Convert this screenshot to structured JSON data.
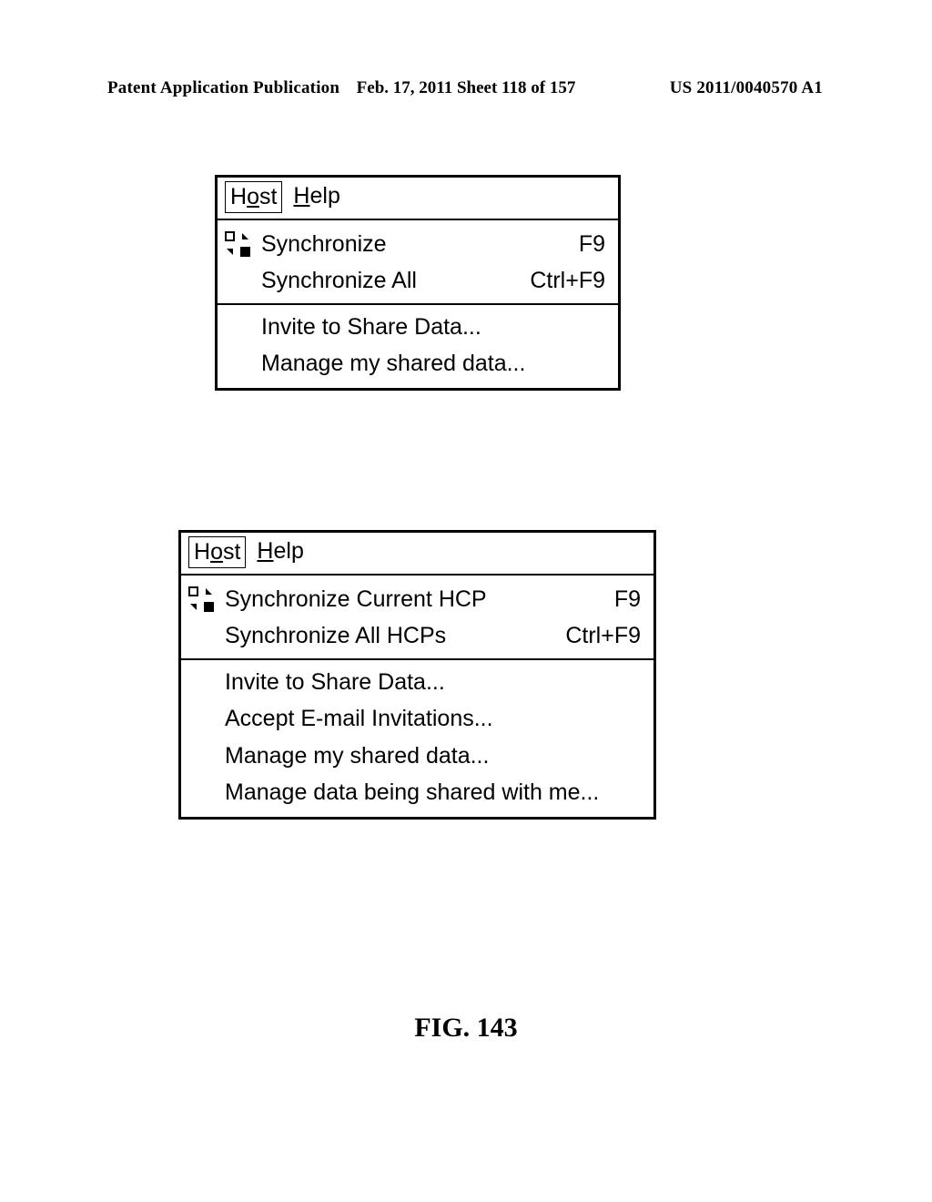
{
  "header": {
    "left": "Patent Application Publication",
    "mid": "Feb. 17, 2011  Sheet 118 of 157",
    "right": "US 2011/0040570 A1"
  },
  "menu1": {
    "menubar": {
      "host_prefix": "H",
      "host_under": "o",
      "host_suffix": "st",
      "help_under": "H",
      "help_suffix": "elp"
    },
    "items": [
      {
        "icon": true,
        "label": "Synchronize",
        "shortcut": "F9"
      },
      {
        "icon": false,
        "label": "Synchronize All",
        "shortcut": "Ctrl+F9"
      }
    ],
    "items_after_sep": [
      {
        "label": "Invite to Share Data..."
      },
      {
        "label": "Manage my shared data..."
      }
    ]
  },
  "menu2": {
    "menubar": {
      "host_prefix": "H",
      "host_under": "o",
      "host_suffix": "st",
      "help_under": "H",
      "help_suffix": "elp"
    },
    "items": [
      {
        "icon": true,
        "label": "Synchronize Current HCP",
        "shortcut": "F9"
      },
      {
        "icon": false,
        "label": "Synchronize All HCPs",
        "shortcut": "Ctrl+F9"
      }
    ],
    "items_after_sep": [
      {
        "label": "Invite to Share Data..."
      },
      {
        "label": "Accept E-mail Invitations..."
      },
      {
        "label": "Manage my shared data..."
      },
      {
        "label": "Manage data being shared with me..."
      }
    ]
  },
  "figure_caption": "FIG. 143"
}
